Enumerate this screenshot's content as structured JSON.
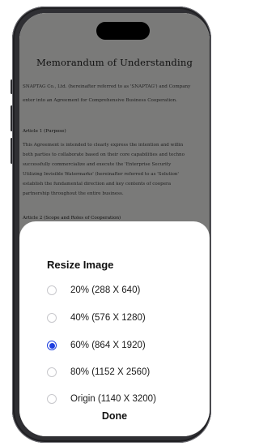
{
  "document": {
    "title": "Memorandum of Understanding",
    "intro_lines": [
      "SNAPTAG Co., Ltd. (hereinafter referred to as 'SNAPTAG') and Company",
      "enter into an Agreement for Comprehensive Business Cooperation."
    ],
    "article1_heading": "Article 1 (Purpose)",
    "article1_lines": [
      "This Agreement is intended to clearly express the intention and willin",
      "both parties to collaborate based on their core capabilities and techno",
      "successfully commercialize and execute the 'Enterprise Security",
      "Utilizing Invisible Watermarks' (hereinafter referred to as 'Solution'",
      "establish the fundamental direction and key contents of coopera",
      "partnership throughout the entire business."
    ],
    "article2_heading": "Article 2 (Scope and Roles of Cooperation)"
  },
  "dialog": {
    "title": "Resize Image",
    "options": [
      {
        "label": "20% (288 X 640)",
        "selected": false
      },
      {
        "label": "40% (576 X 1280)",
        "selected": false
      },
      {
        "label": "60% (864 X 1920)",
        "selected": true
      },
      {
        "label": "80% (1152 X 2560)",
        "selected": false
      },
      {
        "label": "Origin (1140 X 3200)",
        "selected": false
      }
    ],
    "done_label": "Done",
    "accent_color": "#1e3fe0"
  }
}
